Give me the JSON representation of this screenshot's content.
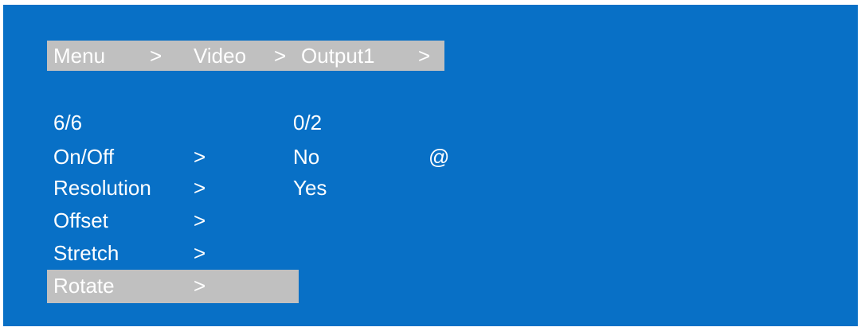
{
  "colors": {
    "background": "#0870c6",
    "highlight": "#c0c0c0",
    "text": "#ffffff"
  },
  "breadcrumb": {
    "menu": "Menu",
    "sep1": ">",
    "video": "Video",
    "sep2": ">",
    "output": "Output1",
    "sep3": ">"
  },
  "left_menu": {
    "counter": "6/6",
    "items": [
      {
        "label": "On/Off",
        "arrow": ">"
      },
      {
        "label": "Resolution",
        "arrow": ">"
      },
      {
        "label": "Offset",
        "arrow": ">"
      },
      {
        "label": "Stretch",
        "arrow": ">"
      },
      {
        "label": "Rotate",
        "arrow": ">"
      }
    ],
    "selected_index": 4
  },
  "right_menu": {
    "counter": "0/2",
    "options": [
      {
        "label": "No",
        "marker": "@"
      },
      {
        "label": "Yes"
      }
    ]
  }
}
